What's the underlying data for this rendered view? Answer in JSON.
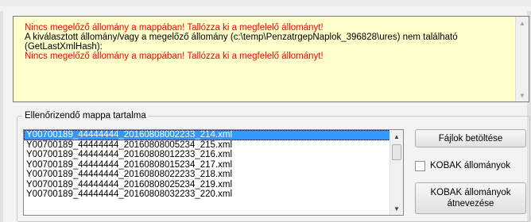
{
  "log": {
    "lines": [
      {
        "text": "Nincs megelőző állomány a mappában! Tallózza ki a megfelelő állományt!",
        "color": "#ff0000"
      },
      {
        "text": "A kiválasztott állomány/vagy a megelőző állomány (c:\\temp\\PenzatrgepNaplok_396828\\ures) nem található",
        "color": "#000000"
      },
      {
        "text": "(GetLastXmlHash):",
        "color": "#000000"
      },
      {
        "text": "Nincs megelőző állomány a mappában! Tallózza ki a megfelelő állományt!",
        "color": "#ff0000"
      }
    ]
  },
  "group": {
    "title": "Ellenőrizendő mappa tartalma",
    "files": [
      "Y00700189_44444444_20160808002233_214.xml",
      "Y00700189_44444444_20160808005234_215.xml",
      "Y00700189_44444444_20160808012233_216.xml",
      "Y00700189_44444444_20160808015234_217.xml",
      "Y00700189_44444444_20160808022233_218.xml",
      "Y00700189_44444444_20160808025234_219.xml",
      "Y00700189_44444444_20160808032233_220.xml"
    ],
    "selected_index": 0,
    "load_button": "Fájlok betöltése",
    "kobak_checkbox": "KOBAK állományok",
    "rename_button_line1": "KOBAK állományok",
    "rename_button_line2": "átnevezése"
  }
}
